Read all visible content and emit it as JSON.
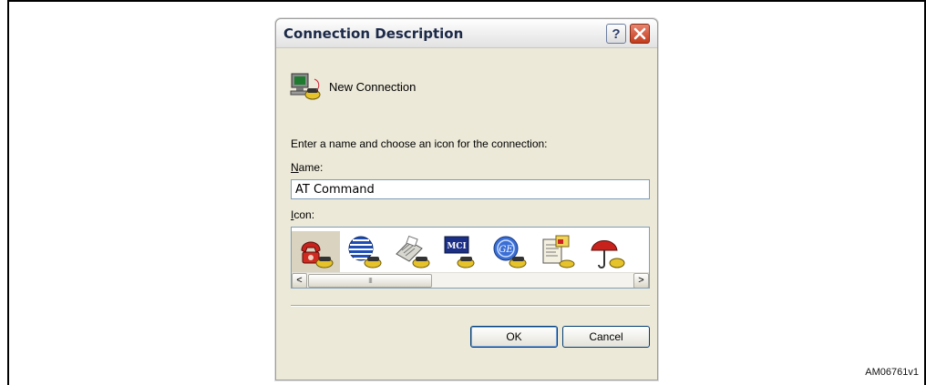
{
  "figure_id": "AM06761v1",
  "dialog": {
    "title": "Connection Description",
    "help_label": "?",
    "close_label": "✕",
    "connection_label": "New Connection",
    "prompt": "Enter a name and choose an icon for the connection:",
    "name_label_key": "N",
    "name_label_rest": "ame:",
    "name_value": "AT Command",
    "icon_label_key": "I",
    "icon_label_rest": "con:",
    "icons": [
      "phone-icon",
      "globe-icon",
      "fax-icon",
      "mci-icon",
      "ge-icon",
      "document-icon",
      "umbrella-icon"
    ],
    "selected_icon_index": 0,
    "scroll_left": "<",
    "scroll_right": ">",
    "scroll_thumb_grip": "III",
    "ok_label": "OK",
    "cancel_label": "Cancel"
  }
}
